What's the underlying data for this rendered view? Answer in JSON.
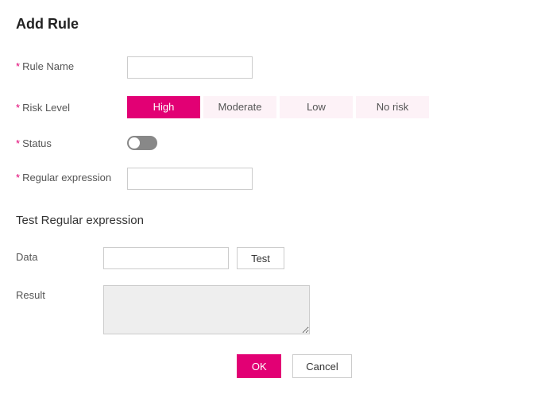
{
  "title": "Add Rule",
  "form": {
    "rule_name": {
      "label": "Rule Name",
      "value": ""
    },
    "risk_level": {
      "label": "Risk Level",
      "options": [
        "High",
        "Moderate",
        "Low",
        "No risk"
      ],
      "selected": "High"
    },
    "status": {
      "label": "Status",
      "value": false
    },
    "regex": {
      "label": "Regular expression",
      "value": ""
    }
  },
  "test_section": {
    "heading": "Test Regular expression",
    "data": {
      "label": "Data",
      "value": ""
    },
    "test_btn": "Test",
    "result": {
      "label": "Result",
      "value": ""
    }
  },
  "footer": {
    "ok": "OK",
    "cancel": "Cancel"
  }
}
